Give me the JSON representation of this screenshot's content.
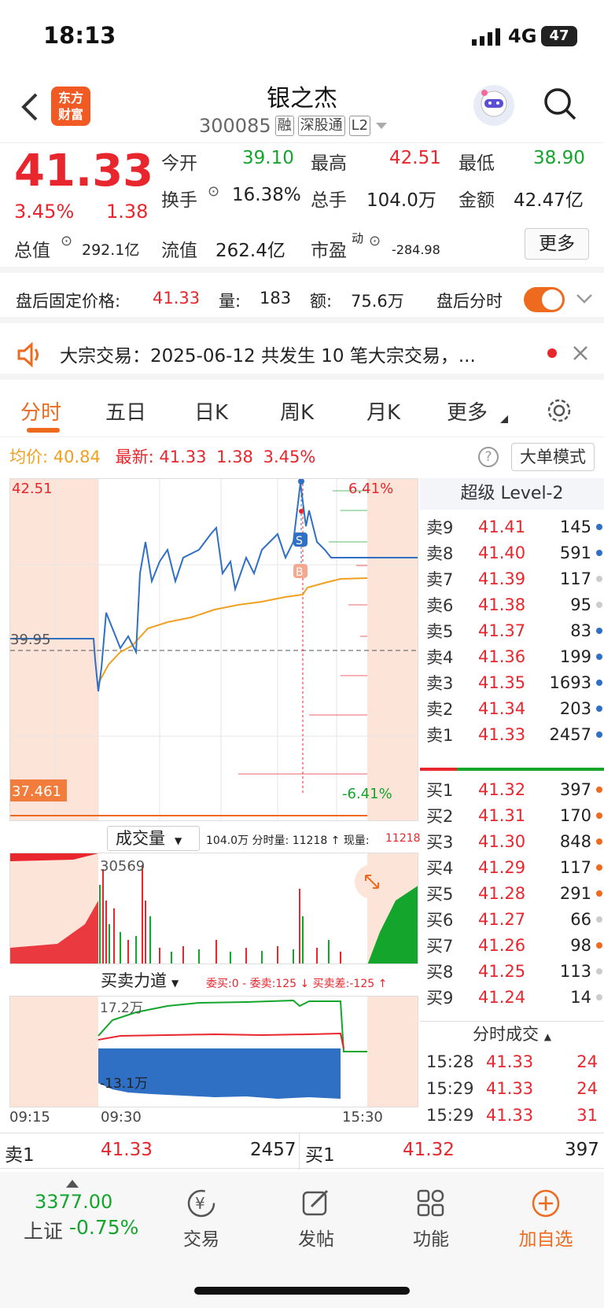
{
  "status": {
    "time": "18:13",
    "network": "4G",
    "battery": "47"
  },
  "header": {
    "title": "银之杰",
    "code": "300085",
    "tags": [
      "融",
      "深股通",
      "L2"
    ],
    "logo": "东方\n财富"
  },
  "quote": {
    "price": "41.33",
    "pct": "3.45%",
    "chg": "1.38",
    "fields": [
      {
        "label": "今开",
        "value": "39.10",
        "color": "#13a52c"
      },
      {
        "label": "最高",
        "value": "42.51",
        "color": "#e8262d"
      },
      {
        "label": "最低",
        "value": "38.90",
        "color": "#13a52c"
      },
      {
        "label": "换手",
        "value": "16.38%",
        "color": "#222"
      },
      {
        "label": "总手",
        "value": "104.0万",
        "color": "#222"
      },
      {
        "label": "金额",
        "value": "42.47亿",
        "color": "#222"
      },
      {
        "label": "总值",
        "value": "292.1亿",
        "color": "#222"
      },
      {
        "label": "流值",
        "value": "262.4亿",
        "color": "#222"
      },
      {
        "label": "市盈",
        "value": "-284.98",
        "color": "#222"
      }
    ],
    "pe_sup": "动",
    "more": "更多"
  },
  "after_hours": {
    "label": "盘后固定价格:",
    "price": "41.33",
    "vol_label": "量:",
    "vol": "183",
    "amt_label": "额:",
    "amt": "75.6万",
    "fenshi": "盘后分时"
  },
  "notice": {
    "text": "大宗交易：2025-06-12 共发生 10 笔大宗交易，..."
  },
  "tabs": [
    "分时",
    "五日",
    "日K",
    "周K",
    "月K",
    "更多"
  ],
  "avg": {
    "avg_label": "均价:",
    "avg": "40.84",
    "new_label": "最新:",
    "new": "41.33",
    "chg": "1.38",
    "pct": "3.45%",
    "bigorder": "大单模式"
  },
  "chart_labels": {
    "top": "42.51",
    "mid": "39.95",
    "bottom": "37.461",
    "top_pct": "6.41%",
    "bottom_pct": "-6.41%",
    "s": "S",
    "b": "B"
  },
  "level2": {
    "title": "超级 Level-2",
    "asks": [
      {
        "label": "卖9",
        "price": "41.41",
        "vol": "145",
        "dot": "#2f6fc4"
      },
      {
        "label": "卖8",
        "price": "41.40",
        "vol": "591",
        "dot": "#2f6fc4"
      },
      {
        "label": "卖7",
        "price": "41.39",
        "vol": "117",
        "dot": "#ccc"
      },
      {
        "label": "卖6",
        "price": "41.38",
        "vol": "95",
        "dot": "#ccc"
      },
      {
        "label": "卖5",
        "price": "41.37",
        "vol": "83",
        "dot": "#2f6fc4"
      },
      {
        "label": "卖4",
        "price": "41.36",
        "vol": "199",
        "dot": "#2f6fc4"
      },
      {
        "label": "卖3",
        "price": "41.35",
        "vol": "1693",
        "dot": "#2f6fc4"
      },
      {
        "label": "卖2",
        "price": "41.34",
        "vol": "203",
        "dot": "#2f6fc4"
      },
      {
        "label": "卖1",
        "price": "41.33",
        "vol": "2457",
        "dot": "#2f6fc4"
      }
    ],
    "bids": [
      {
        "label": "买1",
        "price": "41.32",
        "vol": "397",
        "dot": "#ee6a1f"
      },
      {
        "label": "买2",
        "price": "41.31",
        "vol": "170",
        "dot": "#ee6a1f"
      },
      {
        "label": "买3",
        "price": "41.30",
        "vol": "848",
        "dot": "#ee6a1f"
      },
      {
        "label": "买4",
        "price": "41.29",
        "vol": "117",
        "dot": "#ee6a1f"
      },
      {
        "label": "买5",
        "price": "41.28",
        "vol": "291",
        "dot": "#ee6a1f"
      },
      {
        "label": "买6",
        "price": "41.27",
        "vol": "66",
        "dot": "#ccc"
      },
      {
        "label": "买7",
        "price": "41.26",
        "vol": "98",
        "dot": "#ee6a1f"
      },
      {
        "label": "买8",
        "price": "41.25",
        "vol": "113",
        "dot": "#ccc"
      },
      {
        "label": "买9",
        "price": "41.24",
        "vol": "14",
        "dot": "#ccc"
      }
    ],
    "trades_title": "分时成交",
    "trades": [
      {
        "time": "15:28",
        "price": "41.33",
        "vol": "24"
      },
      {
        "time": "15:29",
        "price": "41.33",
        "vol": "24"
      },
      {
        "time": "15:29",
        "price": "41.33",
        "vol": "31"
      }
    ]
  },
  "volume": {
    "title": "成交量",
    "info": "104.0万 分时量: 11218 ↑ 现量:",
    "now": "11218",
    "peak": "30569"
  },
  "flow": {
    "title": "买卖力道",
    "info": "委买:0 - 委卖:125 ↓ 买卖差:-125 ↑",
    "top": "17.2万",
    "bottom": "-13.1万",
    "t1": "09:15",
    "t2": "09:30",
    "t3": "15:30"
  },
  "book_bar": {
    "sell_label": "卖1",
    "sell_price": "41.33",
    "sell_vol": "2457",
    "buy_label": "买1",
    "buy_price": "41.32",
    "buy_vol": "397"
  },
  "nav": {
    "index_value": "3377.00",
    "index_name": "上证",
    "index_pct": "-0.75%",
    "items": [
      "交易",
      "发帖",
      "功能",
      "加自选"
    ]
  }
}
